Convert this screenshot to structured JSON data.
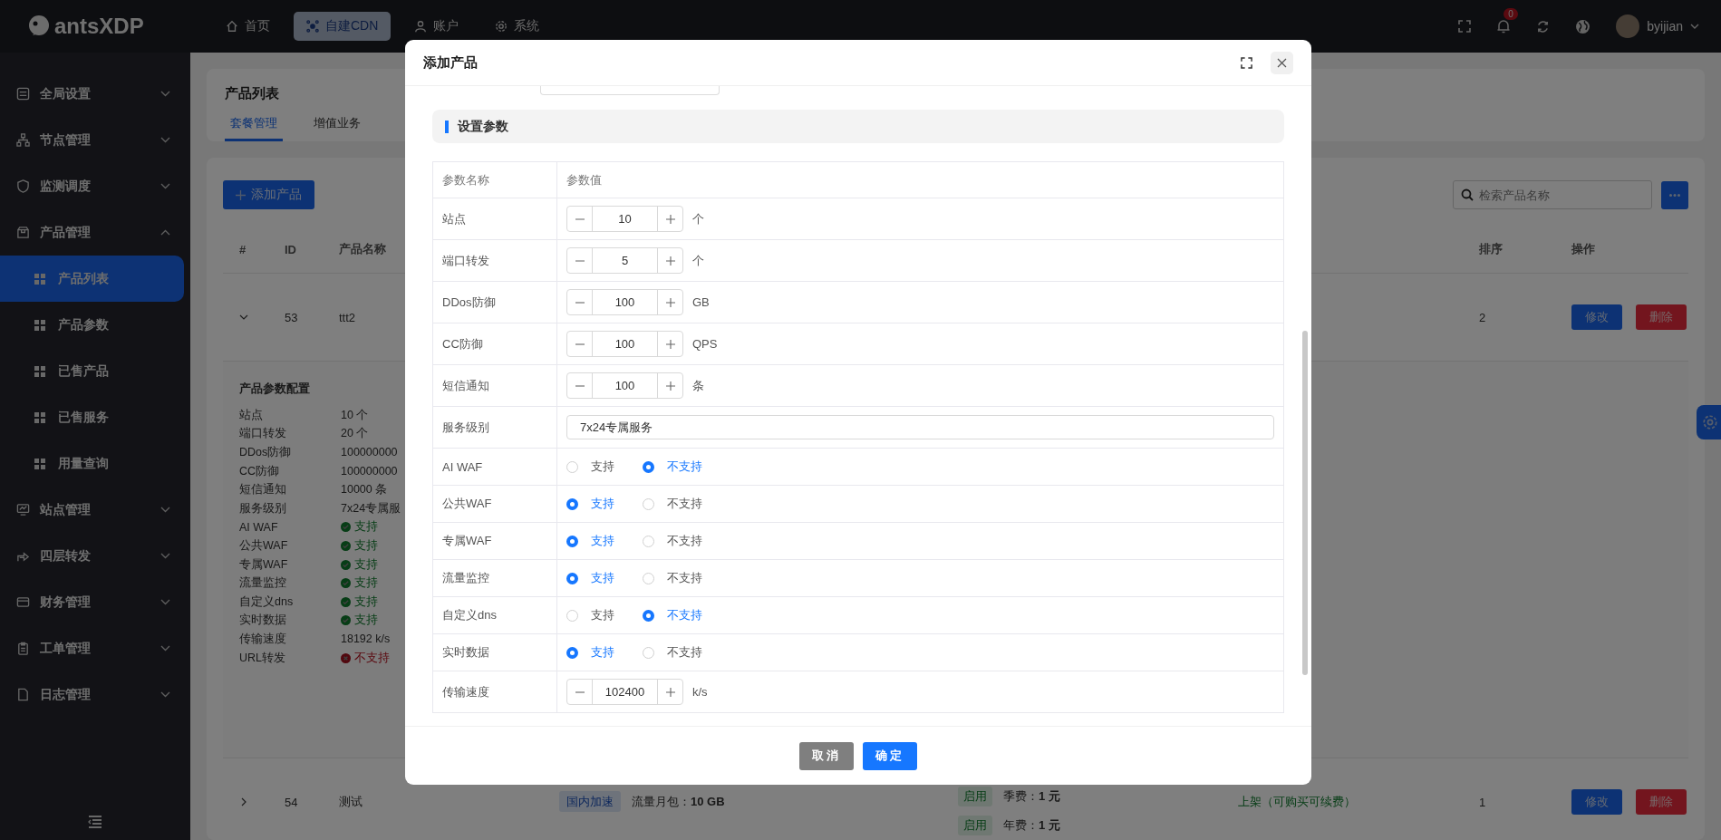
{
  "topbar": {
    "logo": "antsXDP",
    "nav": [
      {
        "label": "首页",
        "selected": false
      },
      {
        "label": "自建CDN",
        "selected": true
      },
      {
        "label": "账户",
        "selected": false
      },
      {
        "label": "系统",
        "selected": false
      }
    ],
    "notifications": "0",
    "user": "byijian"
  },
  "sidebar": {
    "items": [
      {
        "label": "全局设置",
        "expanded": false
      },
      {
        "label": "节点管理",
        "expanded": false
      },
      {
        "label": "监测调度",
        "expanded": false
      },
      {
        "label": "产品管理",
        "expanded": true,
        "children": [
          {
            "label": "产品列表",
            "selected": true
          },
          {
            "label": "产品参数",
            "selected": false
          },
          {
            "label": "已售产品",
            "selected": false
          },
          {
            "label": "已售服务",
            "selected": false
          },
          {
            "label": "用量查询",
            "selected": false
          }
        ]
      },
      {
        "label": "站点管理",
        "expanded": false
      },
      {
        "label": "四层转发",
        "expanded": false
      },
      {
        "label": "财务管理",
        "expanded": false
      },
      {
        "label": "工单管理",
        "expanded": false
      },
      {
        "label": "日志管理",
        "expanded": false
      }
    ]
  },
  "page": {
    "title": "产品列表",
    "tabs": [
      {
        "label": "套餐管理",
        "selected": true
      },
      {
        "label": "增值业务",
        "selected": false
      }
    ]
  },
  "toolbar": {
    "add_button": "添加产品",
    "search": {
      "placeholder": "检索产品名称"
    }
  },
  "table": {
    "columns": {
      "index": "#",
      "id": "ID",
      "name": "产品名称",
      "sort": "排序",
      "actions": "操作"
    },
    "rows": [
      {
        "expanded": true,
        "id": "53",
        "name": "ttt2",
        "sort": "2",
        "actions": [
          "修改",
          "删除"
        ],
        "details": {
          "title": "产品参数配置",
          "params": [
            {
              "kind": "text",
              "name": "站点",
              "value": "10 个"
            },
            {
              "kind": "text",
              "name": "端口转发",
              "value": "20 个"
            },
            {
              "kind": "text",
              "name": "DDos防御",
              "value": "100000000"
            },
            {
              "kind": "text",
              "name": "CC防御",
              "value": "100000000"
            },
            {
              "kind": "text",
              "name": "短信通知",
              "value": "10000 条"
            },
            {
              "kind": "text",
              "name": "服务级别",
              "value": "7x24专属服"
            },
            {
              "kind": "status",
              "name": "AI WAF",
              "value": "支持",
              "supported": true
            },
            {
              "kind": "status",
              "name": "公共WAF",
              "value": "支持",
              "supported": true
            },
            {
              "kind": "status",
              "name": "专属WAF",
              "value": "支持",
              "supported": true
            },
            {
              "kind": "status",
              "name": "流量监控",
              "value": "支持",
              "supported": true
            },
            {
              "kind": "status",
              "name": "自定义dns",
              "value": "支持",
              "supported": true
            },
            {
              "kind": "status",
              "name": "实时数据",
              "value": "支持",
              "supported": true
            },
            {
              "kind": "text",
              "name": "传输速度",
              "value": "18192 k/s"
            },
            {
              "kind": "status",
              "name": "URL转发",
              "value": "不支持",
              "supported": false
            }
          ]
        }
      },
      {
        "expanded": false,
        "id": "54",
        "name": "测试",
        "region": "国内加速",
        "traffic": "流量月包：**10 GB**",
        "fees": [
          {
            "status": "启用",
            "text": "季费：**1 元**"
          },
          {
            "status": "启用",
            "text": "年费：**1 元**"
          }
        ],
        "sale_status": "上架（可购买可续费）",
        "sort": "1",
        "actions": [
          "修改",
          "删除"
        ]
      }
    ]
  },
  "modal": {
    "title": "添加产品",
    "section": "设置参数",
    "columns": [
      "参数名称",
      "参数值"
    ],
    "params": [
      {
        "kind": "number",
        "name": "站点",
        "value": "10",
        "unit": "个"
      },
      {
        "kind": "number",
        "name": "端口转发",
        "value": "5",
        "unit": "个"
      },
      {
        "kind": "number",
        "name": "DDos防御",
        "value": "100",
        "unit": "GB"
      },
      {
        "kind": "number",
        "name": "CC防御",
        "value": "100",
        "unit": "QPS"
      },
      {
        "kind": "number",
        "name": "短信通知",
        "value": "100",
        "unit": "条"
      },
      {
        "kind": "text",
        "name": "服务级别",
        "value": "7x24专属服务"
      },
      {
        "kind": "radio",
        "name": "AI WAF",
        "options": [
          {
            "label": "支持",
            "selected": false
          },
          {
            "label": "不支持",
            "selected": true
          }
        ]
      },
      {
        "kind": "radio",
        "name": "公共WAF",
        "options": [
          {
            "label": "支持",
            "selected": true
          },
          {
            "label": "不支持",
            "selected": false
          }
        ]
      },
      {
        "kind": "radio",
        "name": "专属WAF",
        "options": [
          {
            "label": "支持",
            "selected": true
          },
          {
            "label": "不支持",
            "selected": false
          }
        ]
      },
      {
        "kind": "radio",
        "name": "流量监控",
        "options": [
          {
            "label": "支持",
            "selected": true
          },
          {
            "label": "不支持",
            "selected": false
          }
        ]
      },
      {
        "kind": "radio",
        "name": "自定义dns",
        "options": [
          {
            "label": "支持",
            "selected": false
          },
          {
            "label": "不支持",
            "selected": true
          }
        ]
      },
      {
        "kind": "radio",
        "name": "实时数据",
        "options": [
          {
            "label": "支持",
            "selected": true
          },
          {
            "label": "不支持",
            "selected": false
          }
        ]
      },
      {
        "kind": "number",
        "name": "传输速度",
        "value": "102400",
        "unit": "k/s"
      }
    ],
    "buttons": [
      {
        "label": "取消",
        "kind": "cancel"
      },
      {
        "label": "确定",
        "kind": "primary"
      }
    ]
  }
}
